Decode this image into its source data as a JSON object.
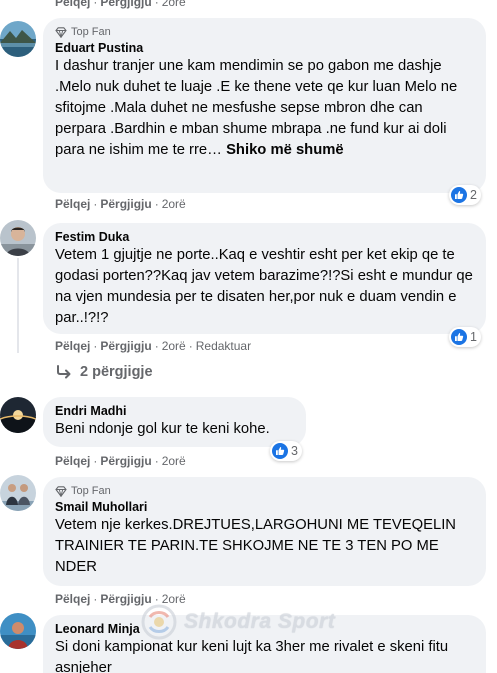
{
  "actions": {
    "like": "Pëlqej",
    "reply": "Përgjigju",
    "edited": "Redaktuar",
    "sep": "·"
  },
  "comments": [
    {
      "time": "2orë"
    },
    {
      "badge": "Top Fan",
      "author": "Eduart Pustina",
      "text": "I dashur tranjer une kam mendimin se po gabon me dashje .Melo nuk duhet te luaje .E ke thene vete qe kur luan Melo ne sfitojme .Mala duhet ne mesfushe sepse mbron dhe can perpara .Bardhin e mban shume mbrapa .ne fund kur ai doli para ne ishim me te rre…",
      "see_more": "Shiko më shumë",
      "reactions": "2",
      "time": "2orë"
    },
    {
      "author": "Festim Duka",
      "text": "Vetem 1 gjujtje ne porte..Kaq e veshtir esht per ket ekip qe te godasi porten??Kaq jav vetem barazime?!?Si esht e mundur qe na vjen mundesia per te disaten her,por nuk e duam vendin e par..!?!?",
      "reactions": "1",
      "time": "2orë",
      "replies_label": "2 përgjigje"
    },
    {
      "author": "Endri Madhi",
      "text": "Beni ndonje gol kur te keni kohe.",
      "reactions": "3",
      "time": "2orë"
    },
    {
      "badge": "Top Fan",
      "author": "Smail Muhollari",
      "text": "Vetem nje kerkes.DREJTUES,LARGOHUNI ME TEVEQELIN TRAINIER TE PARIN.TE SHKOJME NE TE 3 TEN PO ME NDER",
      "time": "2orë"
    },
    {
      "author": "Leonard Minja",
      "text": "Si doni kampionat kur keni lujt ka 3her me rivalet e skeni fitu asnjeher"
    }
  ],
  "watermark": "Shkodra Sport",
  "colors": {
    "bubble": "#f0f2f5",
    "like_blue": "#1b74e4",
    "meta_gray": "#65676b"
  },
  "icons": {
    "badge": "diamond-icon",
    "reaction": "thumbs-up-icon",
    "replies": "reply-arrow-icon"
  }
}
